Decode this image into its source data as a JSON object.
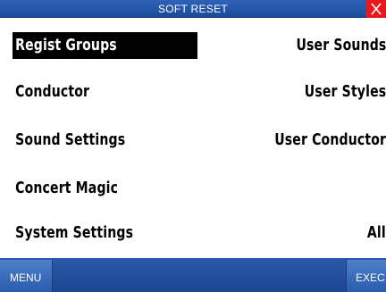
{
  "title": "SOFT RESET",
  "close_icon": "close-x-icon",
  "colors": {
    "title_bar": "#1f4fa3",
    "close_button": "#e8181c",
    "selection_bg": "#000000",
    "bottom_bar": "#1f4c98"
  },
  "left_options": [
    {
      "label": "Regist Groups",
      "selected": true
    },
    {
      "label": "Conductor",
      "selected": false
    },
    {
      "label": "Sound Settings",
      "selected": false
    },
    {
      "label": "Concert Magic",
      "selected": false
    },
    {
      "label": "System Settings",
      "selected": false
    }
  ],
  "right_options": [
    {
      "label": "User Sounds"
    },
    {
      "label": "User Styles"
    },
    {
      "label": "User Conductor"
    },
    {
      "label": "All"
    }
  ],
  "softkeys": {
    "menu": "MENU",
    "exec": "EXEC"
  }
}
